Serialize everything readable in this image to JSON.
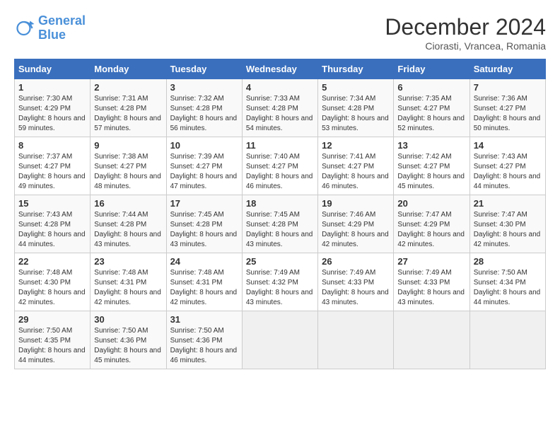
{
  "header": {
    "logo_line1": "General",
    "logo_line2": "Blue",
    "title": "December 2024",
    "subtitle": "Ciorasti, Vrancea, Romania"
  },
  "days_of_week": [
    "Sunday",
    "Monday",
    "Tuesday",
    "Wednesday",
    "Thursday",
    "Friday",
    "Saturday"
  ],
  "weeks": [
    [
      {
        "day": "1",
        "sunrise": "7:30 AM",
        "sunset": "4:29 PM",
        "daylight": "8 hours and 59 minutes."
      },
      {
        "day": "2",
        "sunrise": "7:31 AM",
        "sunset": "4:28 PM",
        "daylight": "8 hours and 57 minutes."
      },
      {
        "day": "3",
        "sunrise": "7:32 AM",
        "sunset": "4:28 PM",
        "daylight": "8 hours and 56 minutes."
      },
      {
        "day": "4",
        "sunrise": "7:33 AM",
        "sunset": "4:28 PM",
        "daylight": "8 hours and 54 minutes."
      },
      {
        "day": "5",
        "sunrise": "7:34 AM",
        "sunset": "4:28 PM",
        "daylight": "8 hours and 53 minutes."
      },
      {
        "day": "6",
        "sunrise": "7:35 AM",
        "sunset": "4:27 PM",
        "daylight": "8 hours and 52 minutes."
      },
      {
        "day": "7",
        "sunrise": "7:36 AM",
        "sunset": "4:27 PM",
        "daylight": "8 hours and 50 minutes."
      }
    ],
    [
      {
        "day": "8",
        "sunrise": "7:37 AM",
        "sunset": "4:27 PM",
        "daylight": "8 hours and 49 minutes."
      },
      {
        "day": "9",
        "sunrise": "7:38 AM",
        "sunset": "4:27 PM",
        "daylight": "8 hours and 48 minutes."
      },
      {
        "day": "10",
        "sunrise": "7:39 AM",
        "sunset": "4:27 PM",
        "daylight": "8 hours and 47 minutes."
      },
      {
        "day": "11",
        "sunrise": "7:40 AM",
        "sunset": "4:27 PM",
        "daylight": "8 hours and 46 minutes."
      },
      {
        "day": "12",
        "sunrise": "7:41 AM",
        "sunset": "4:27 PM",
        "daylight": "8 hours and 46 minutes."
      },
      {
        "day": "13",
        "sunrise": "7:42 AM",
        "sunset": "4:27 PM",
        "daylight": "8 hours and 45 minutes."
      },
      {
        "day": "14",
        "sunrise": "7:43 AM",
        "sunset": "4:27 PM",
        "daylight": "8 hours and 44 minutes."
      }
    ],
    [
      {
        "day": "15",
        "sunrise": "7:43 AM",
        "sunset": "4:28 PM",
        "daylight": "8 hours and 44 minutes."
      },
      {
        "day": "16",
        "sunrise": "7:44 AM",
        "sunset": "4:28 PM",
        "daylight": "8 hours and 43 minutes."
      },
      {
        "day": "17",
        "sunrise": "7:45 AM",
        "sunset": "4:28 PM",
        "daylight": "8 hours and 43 minutes."
      },
      {
        "day": "18",
        "sunrise": "7:45 AM",
        "sunset": "4:28 PM",
        "daylight": "8 hours and 43 minutes."
      },
      {
        "day": "19",
        "sunrise": "7:46 AM",
        "sunset": "4:29 PM",
        "daylight": "8 hours and 42 minutes."
      },
      {
        "day": "20",
        "sunrise": "7:47 AM",
        "sunset": "4:29 PM",
        "daylight": "8 hours and 42 minutes."
      },
      {
        "day": "21",
        "sunrise": "7:47 AM",
        "sunset": "4:30 PM",
        "daylight": "8 hours and 42 minutes."
      }
    ],
    [
      {
        "day": "22",
        "sunrise": "7:48 AM",
        "sunset": "4:30 PM",
        "daylight": "8 hours and 42 minutes."
      },
      {
        "day": "23",
        "sunrise": "7:48 AM",
        "sunset": "4:31 PM",
        "daylight": "8 hours and 42 minutes."
      },
      {
        "day": "24",
        "sunrise": "7:48 AM",
        "sunset": "4:31 PM",
        "daylight": "8 hours and 42 minutes."
      },
      {
        "day": "25",
        "sunrise": "7:49 AM",
        "sunset": "4:32 PM",
        "daylight": "8 hours and 43 minutes."
      },
      {
        "day": "26",
        "sunrise": "7:49 AM",
        "sunset": "4:33 PM",
        "daylight": "8 hours and 43 minutes."
      },
      {
        "day": "27",
        "sunrise": "7:49 AM",
        "sunset": "4:33 PM",
        "daylight": "8 hours and 43 minutes."
      },
      {
        "day": "28",
        "sunrise": "7:50 AM",
        "sunset": "4:34 PM",
        "daylight": "8 hours and 44 minutes."
      }
    ],
    [
      {
        "day": "29",
        "sunrise": "7:50 AM",
        "sunset": "4:35 PM",
        "daylight": "8 hours and 44 minutes."
      },
      {
        "day": "30",
        "sunrise": "7:50 AM",
        "sunset": "4:36 PM",
        "daylight": "8 hours and 45 minutes."
      },
      {
        "day": "31",
        "sunrise": "7:50 AM",
        "sunset": "4:36 PM",
        "daylight": "8 hours and 46 minutes."
      },
      null,
      null,
      null,
      null
    ]
  ]
}
